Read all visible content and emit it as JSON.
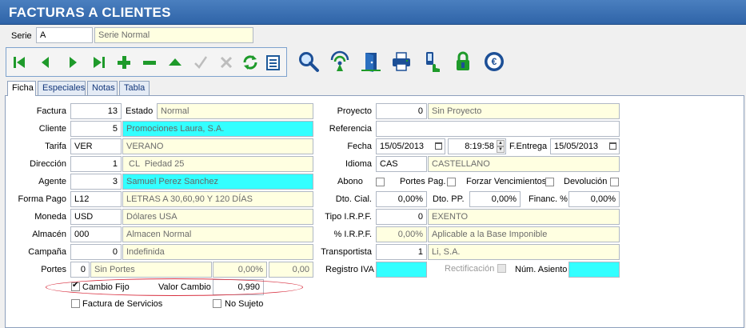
{
  "title": "FACTURAS A CLIENTES",
  "serie": {
    "label": "Serie",
    "code": "A",
    "name": "Serie Normal"
  },
  "tabs": [
    "Ficha",
    "Especiales",
    "Notas",
    "Tabla"
  ],
  "left": {
    "factura": {
      "label": "Factura",
      "value": "13"
    },
    "estado": {
      "label": "Estado",
      "value": "Normal"
    },
    "cliente": {
      "label": "Cliente",
      "value": "5",
      "name": "Promociones Laura, S.A."
    },
    "tarifa": {
      "label": "Tarifa",
      "code": "VER",
      "name": "VERANO"
    },
    "direccion": {
      "label": "Dirección",
      "value": "1",
      "name": " CL  Piedad 25"
    },
    "agente": {
      "label": "Agente",
      "value": "3",
      "name": "Samuel Perez Sanchez"
    },
    "forma_pago": {
      "label": "Forma Pago",
      "code": "L12",
      "name": "LETRAS A 30,60,90 Y 120 DÍAS"
    },
    "moneda": {
      "label": "Moneda",
      "code": "USD",
      "name": "Dólares USA"
    },
    "almacen": {
      "label": "Almacén",
      "code": "000",
      "name": "Almacen Normal"
    },
    "campana": {
      "label": "Campaña",
      "value": "0",
      "name": "Indefinida"
    },
    "portes": {
      "label": "Portes",
      "value": "0",
      "name": "Sin Portes",
      "pct": "0,00%",
      "amount": "0,00"
    },
    "cambio_fijo": {
      "label": "Cambio Fijo",
      "checked": true
    },
    "valor_cambio": {
      "label": "Valor Cambio",
      "value": "0,990"
    },
    "factura_servicios": {
      "label": "Factura de Servicios",
      "checked": false
    },
    "no_sujeto": {
      "label": "No Sujeto",
      "checked": false
    }
  },
  "right": {
    "proyecto": {
      "label": "Proyecto",
      "value": "0",
      "name": "Sin Proyecto"
    },
    "referencia": {
      "label": "Referencia",
      "value": ""
    },
    "fecha": {
      "label": "Fecha",
      "date": "15/05/2013",
      "time": "8:19:58"
    },
    "f_entrega": {
      "label": "F.Entrega",
      "date": "15/05/2013"
    },
    "idioma": {
      "label": "Idioma",
      "code": "CAS",
      "name": "CASTELLANO"
    },
    "abono": {
      "label": "Abono"
    },
    "portes_pag": {
      "label": "Portes Pag."
    },
    "forzar_venc": {
      "label": "Forzar Vencimientos"
    },
    "devolucion": {
      "label": "Devolución"
    },
    "dto_cial": {
      "label": "Dto. Cial.",
      "value": "0,00%"
    },
    "dto_pp": {
      "label": "Dto. PP.",
      "value": "0,00%"
    },
    "financ": {
      "label": "Financ. %",
      "value": "0,00%"
    },
    "tipo_irpf": {
      "label": "Tipo I.R.P.F.",
      "value": "0",
      "name": "EXENTO"
    },
    "pct_irpf": {
      "label": "% I.R.P.F.",
      "value": "0,00%",
      "name": "Aplicable a la Base Imponible"
    },
    "transportista": {
      "label": "Transportista",
      "value": "1",
      "name": "Li, S.A."
    },
    "registro_iva": {
      "label": "Registro IVA"
    },
    "rectificacion": {
      "label": "Rectificación"
    },
    "num_asiento": {
      "label": "Núm. Asiento"
    }
  },
  "colors": {
    "title_bar": "#2f64a8",
    "toolbar_green": "#1e9a2a",
    "highlight_cyan": "#33ffff",
    "readonly_yellow": "#ffffe1"
  }
}
